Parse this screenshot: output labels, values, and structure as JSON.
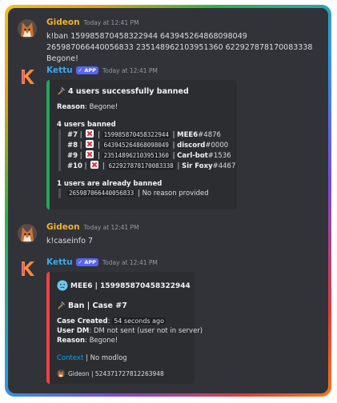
{
  "colors": {
    "background": "#313338",
    "embed_background": "#2b2d31",
    "embed_accent": "#23a55a",
    "user_name": "#f0b232",
    "bot_name": "#3ba8f0",
    "link": "#00a8fc",
    "badge": "#5865f2"
  },
  "messages": [
    {
      "author": "Gideon",
      "timestamp": "Today at 12:41 PM",
      "content": "k!ban 159985870458322944 643945264868098049 265987066440056833 235148962103951360 622927878170083338 Begone!"
    },
    {
      "author": "Kettu",
      "badge": "APP",
      "timestamp": "Today at 12:41 PM",
      "embed": {
        "title": "4 users successfully banned",
        "reason_label": "Reason",
        "reason": "Begone!",
        "banned_heading": "4 users banned",
        "banned": [
          {
            "case": "#7",
            "id": "159985870458322944",
            "name": "MEE6",
            "discriminator": "#4876"
          },
          {
            "case": "#8",
            "id": "643945264868098049",
            "name": "discord",
            "discriminator": "#0000"
          },
          {
            "case": "#9",
            "id": "235148962103951360",
            "name": "Carl-bot",
            "discriminator": "#1536"
          },
          {
            "case": "#10",
            "id": "622927878170083338",
            "name": "Sir Foxy",
            "discriminator": "#4467"
          }
        ],
        "already_heading": "1 users are already banned",
        "already": [
          {
            "id": "265987066440056833",
            "note": "No reason provided"
          }
        ]
      }
    },
    {
      "author": "Gideon",
      "timestamp": "Today at 12:41 PM",
      "content": "k!caseinfo 7"
    },
    {
      "author": "Kettu",
      "badge": "APP",
      "timestamp": "Today at 12:41 PM",
      "embed": {
        "author_line": "MEE6 | 159985870458322944",
        "title": "Ban | Case #7",
        "case_created_label": "Case Created",
        "case_created": "54 seconds ago",
        "user_dm_label": "User DM",
        "user_dm": "DM not sent (user not in server)",
        "reason_label": "Reason",
        "reason": "Begone!",
        "context_link": "Context",
        "no_modlog": "No modlog",
        "footer": "Gideon | 524371727812263948"
      }
    }
  ],
  "icons": [
    "fox-avatar",
    "kettu-logo-icon",
    "hammer-icon",
    "x-mark-icon",
    "verified-check-icon",
    "confused-face-icon"
  ]
}
